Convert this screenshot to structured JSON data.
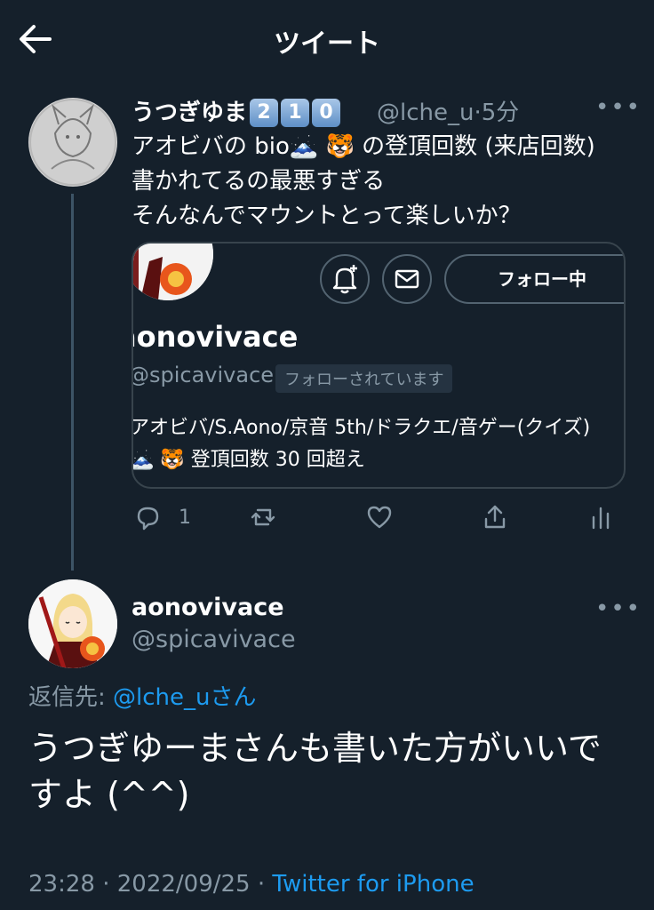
{
  "header": {
    "title": "ツイート",
    "back_icon": "arrow-left-icon"
  },
  "tweet1": {
    "name": "うつぎゆま",
    "name_keycaps": [
      "2",
      "1",
      "0"
    ],
    "handle": "@lche_u",
    "separator": "·",
    "time": "5分",
    "text": "アオビバの bio🗻 🐯 の登頂回数 (来店回数)\n書かれてるの最悪すぎる\nそんなんでマウントとって楽しいか？",
    "card": {
      "name": "aonovivace",
      "handle": "@spicavivace",
      "follows_you": "フォローされています",
      "follow_button": "フォロー中",
      "bio": "アオビバ/S.Aono/京音 5th/ドラクエ/音ゲー(クイズ)\n🗻 🐯 登頂回数 30 回超え"
    },
    "actions": {
      "reply_count": "1"
    }
  },
  "tweet2": {
    "name": "aonovivace",
    "handle": "@spicavivace",
    "reply_label": "返信先:",
    "reply_mention": "@lche_u",
    "reply_suffix": "さん",
    "text": "うつぎゆーまさんも書いた方がいいですよ (^^)",
    "time": "23:28",
    "separator": "·",
    "date": "2022/09/25",
    "source": "Twitter for iPhone"
  },
  "colors": {
    "background": "#15202b",
    "accent": "#1d9bf0",
    "muted": "#8899a6",
    "border": "#38444d"
  }
}
